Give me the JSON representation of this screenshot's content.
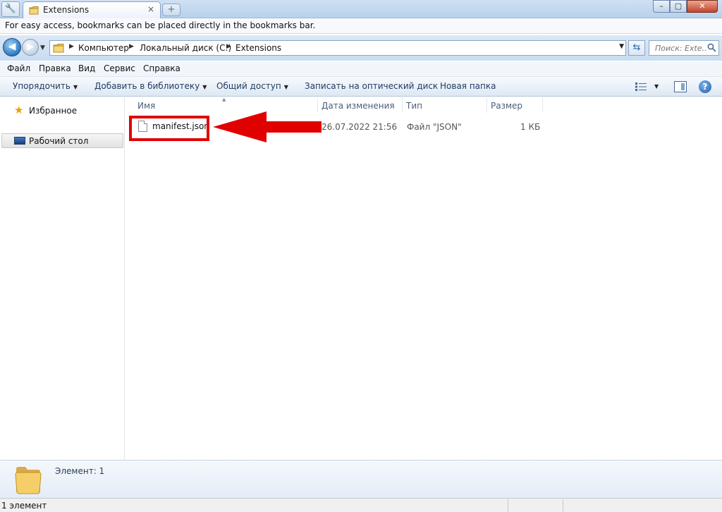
{
  "tab": {
    "title": "Extensions",
    "close": "×",
    "new_tab": "+"
  },
  "window": {
    "min": "–",
    "max": "▢",
    "close": "✕"
  },
  "bookmarks_bar": {
    "message": "For easy access, bookmarks can be placed directly in the bookmarks bar."
  },
  "address_bar": {
    "breadcrumbs": [
      "Компьютер",
      "Локальный диск (C:)",
      "Extensions"
    ],
    "search_placeholder": "Поиск: Exte..."
  },
  "menu": [
    "Файл",
    "Правка",
    "Вид",
    "Сервис",
    "Справка"
  ],
  "commands": [
    "Упорядочить",
    "Добавить в библиотеку",
    "Общий доступ",
    "Записать на оптический диск",
    "Новая папка"
  ],
  "nav_pane": {
    "favorites": "Избранное",
    "desktop": "Рабочий стол"
  },
  "columns": [
    "Имя",
    "Дата изменения",
    "Тип",
    "Размер"
  ],
  "files": [
    {
      "name": "manifest.json",
      "modified": "26.07.2022 21:56",
      "type": "Файл \"JSON\"",
      "size": "1 КБ"
    }
  ],
  "annotation": {
    "color": "#e10000"
  },
  "details_pane": {
    "count": "Элемент: 1"
  },
  "status_bar": {
    "text": "1 элемент"
  }
}
